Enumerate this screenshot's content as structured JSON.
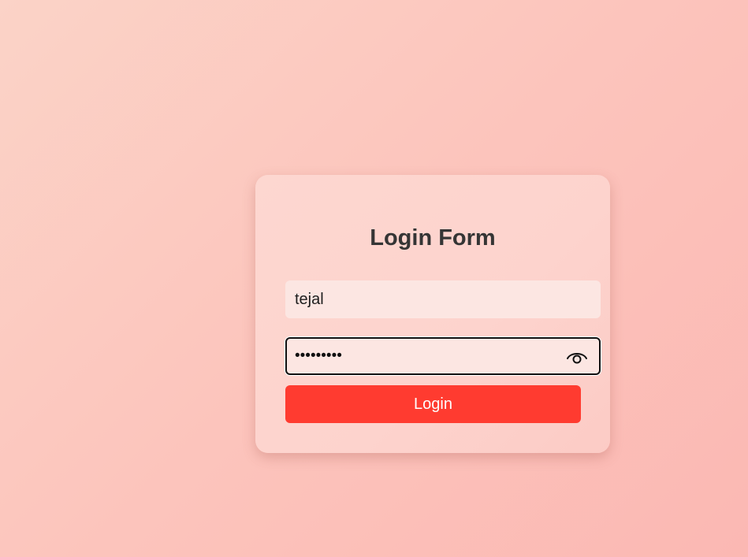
{
  "form": {
    "title": "Login Form",
    "username_value": "tejal",
    "password_masked": "•••••••••",
    "login_label": "Login"
  },
  "icons": {
    "password_toggle": "eye-icon"
  },
  "colors": {
    "accent": "#ff3b30",
    "field_background": "#fce6e2",
    "title_text": "#353535"
  }
}
